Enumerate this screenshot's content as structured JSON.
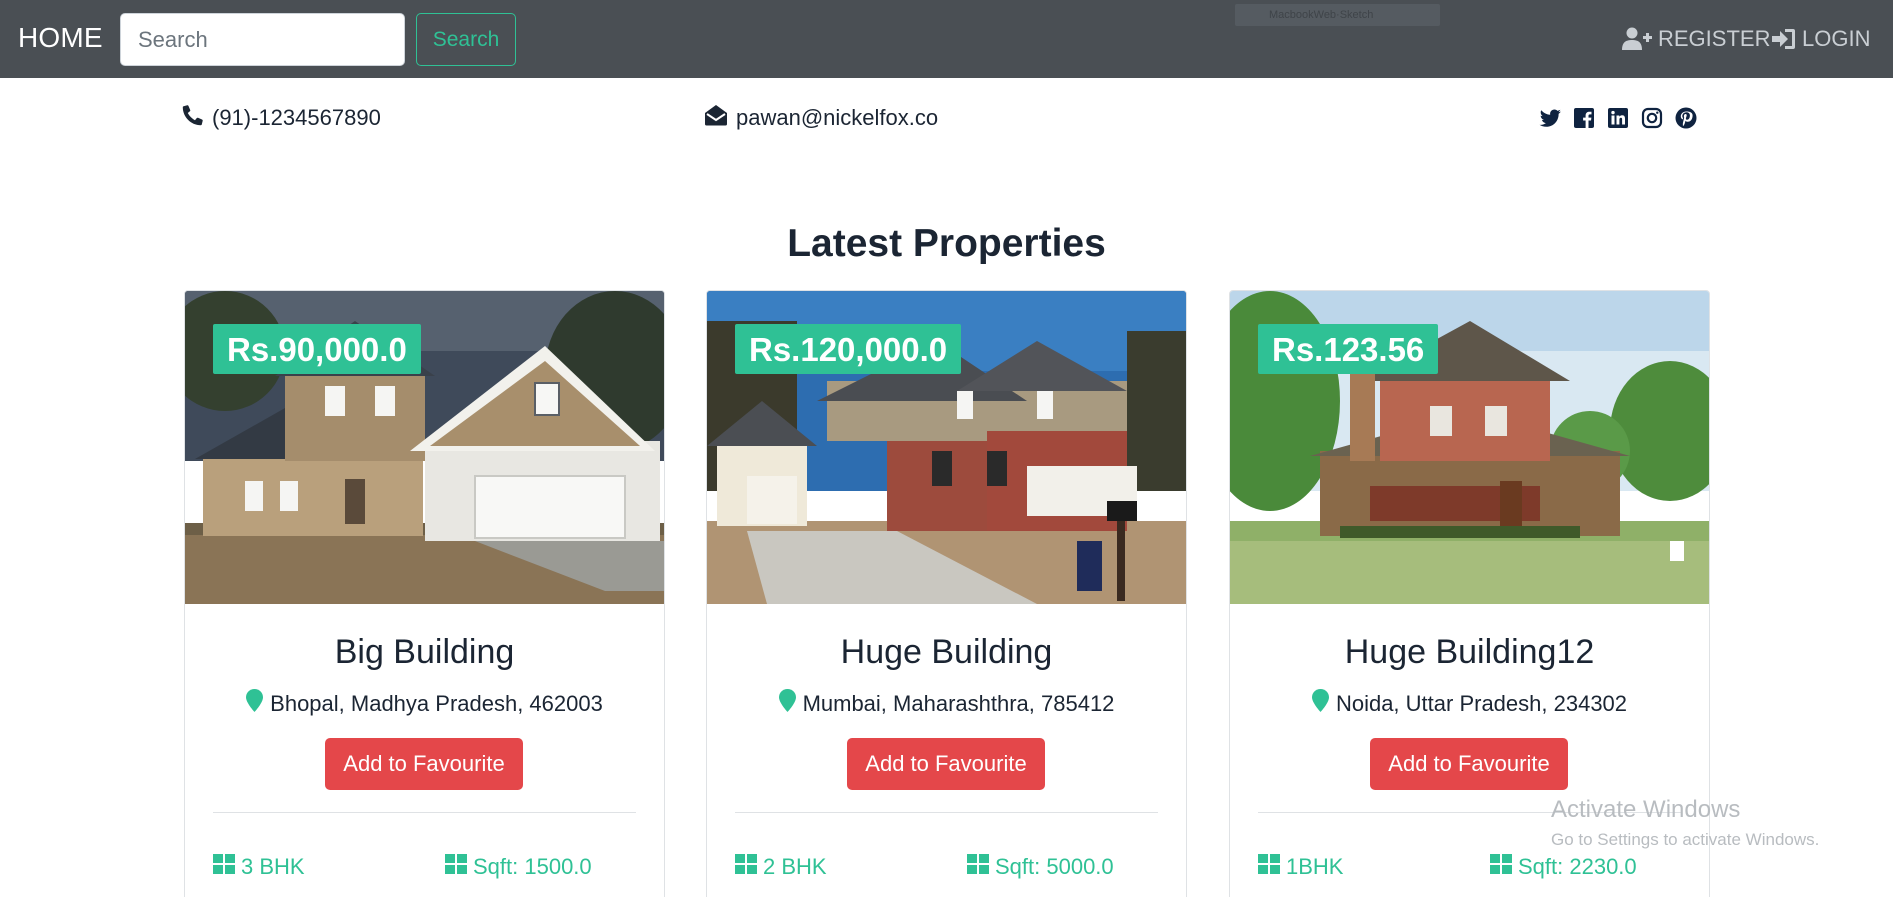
{
  "nav": {
    "brand": "HOME",
    "search_placeholder": "Search",
    "search_button": "Search",
    "faint_tab_label": "MacbookWeb·Sketch",
    "register": "REGISTER",
    "login": "LOGIN"
  },
  "contact": {
    "phone": "(91)-1234567890",
    "email": "pawan@nickelfox.co",
    "social_icons": [
      "twitter-icon",
      "facebook-icon",
      "linkedin-icon",
      "instagram-icon",
      "pinterest-icon"
    ]
  },
  "section_title": "Latest Properties",
  "properties": [
    {
      "price": "Rs.90,000.0",
      "title": "Big Building",
      "location": "Bhopal, Madhya Pradesh, 462003",
      "button": "Add to Favourite",
      "bhk": "3 BHK",
      "sqft": "Sqft: 1500.0"
    },
    {
      "price": "Rs.120,000.0",
      "title": "Huge Building",
      "location": "Mumbai, Maharashthra, 785412",
      "button": "Add to Favourite",
      "bhk": "2 BHK",
      "sqft": "Sqft: 5000.0"
    },
    {
      "price": "Rs.123.56",
      "title": "Huge Building12",
      "location": "Noida, Uttar Pradesh, 234302",
      "button": "Add to Favourite",
      "bhk": "1BHK",
      "sqft": "Sqft: 2230.0"
    }
  ],
  "watermark": {
    "title": "Activate Windows",
    "subtitle": "Go to Settings to activate Windows."
  },
  "colors": {
    "navbar": "#4a4f54",
    "accent": "#2fc195",
    "favourite": "#e4474a",
    "text": "#1b2533"
  }
}
